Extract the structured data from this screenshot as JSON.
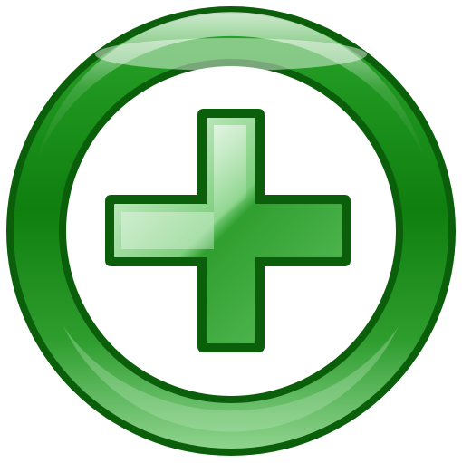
{
  "icon": {
    "name": "add-circle-icon",
    "symbol": "plus",
    "style": "glossy",
    "colors": {
      "dark_outline": "#0b5f0b",
      "ring_mid": "#1f961f",
      "ring_light": "#7fd07f",
      "highlight": "#e8f7e8",
      "cross_fill": "#3fae3f",
      "cross_light": "#d6f0d6",
      "background": "#ffffff"
    }
  }
}
